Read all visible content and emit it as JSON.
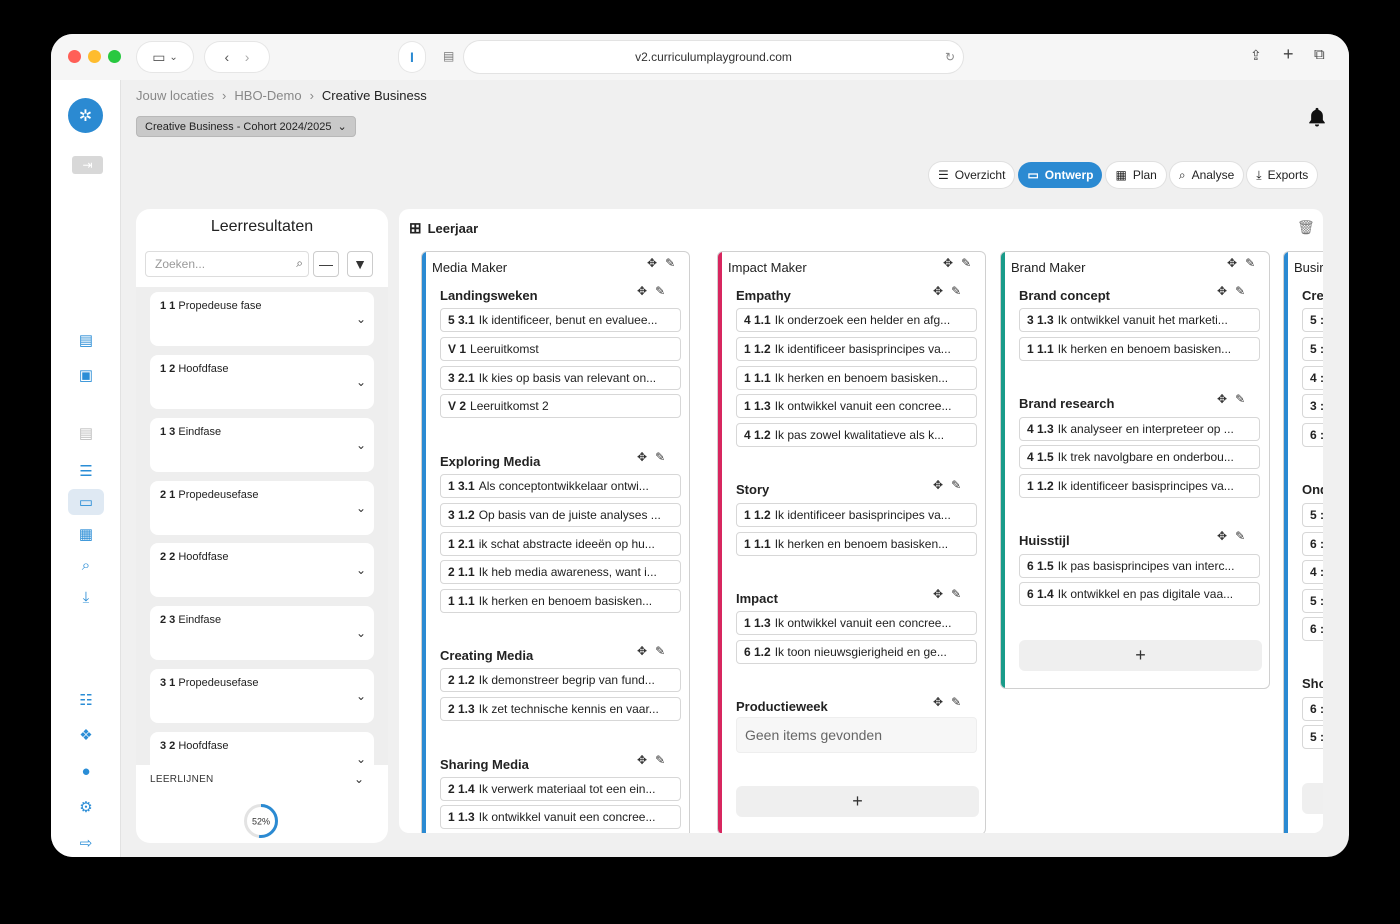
{
  "browser": {
    "url": "v2.curriculumplayground.com"
  },
  "breadcrumbs": [
    "Jouw locaties",
    "HBO-Demo",
    "Creative Business"
  ],
  "cohort": "Creative Business - Cohort 2024/2025",
  "tabs": [
    {
      "label": "Overzicht",
      "icon": "list-icon",
      "active": false
    },
    {
      "label": "Ontwerp",
      "icon": "layout-icon",
      "active": true
    },
    {
      "label": "Plan",
      "icon": "calendar-icon",
      "active": false
    },
    {
      "label": "Analyse",
      "icon": "search-icon",
      "active": false
    },
    {
      "label": "Exports",
      "icon": "download-icon",
      "active": false
    }
  ],
  "leerresultaten": {
    "title": "Leerresultaten",
    "search_placeholder": "Zoeken...",
    "phases": [
      {
        "num": "1 1",
        "label": "Propedeuse fase"
      },
      {
        "num": "1 2",
        "label": "Hoofdfase"
      },
      {
        "num": "1 3",
        "label": "Eindfase"
      },
      {
        "num": "2 1",
        "label": "Propedeusefase"
      },
      {
        "num": "2 2",
        "label": "Hoofdfase"
      },
      {
        "num": "2 3",
        "label": "Eindfase"
      },
      {
        "num": "3 1",
        "label": "Propedeusefase"
      },
      {
        "num": "3 2",
        "label": "Hoofdfase"
      }
    ],
    "leerlijnen": "LEERLIJNEN",
    "progress": "52%"
  },
  "board": {
    "title": "Leerjaar",
    "columns": [
      {
        "title": "Media Maker",
        "color": "#2b8ad2",
        "groups": [
          {
            "title": "Landingsweken",
            "items": [
              {
                "code": "5 3.1",
                "text": "Ik identificeer, benut en evaluee..."
              },
              {
                "code": "V 1",
                "text": "Leeruitkomst"
              },
              {
                "code": "3 2.1",
                "text": "Ik kies op basis van relevant on..."
              },
              {
                "code": "V 2",
                "text": "Leeruitkomst 2"
              }
            ]
          },
          {
            "title": "Exploring Media",
            "items": [
              {
                "code": "1 3.1",
                "text": "Als conceptontwikkelaar ontwi..."
              },
              {
                "code": "3 1.2",
                "text": "Op basis van de juiste analyses ..."
              },
              {
                "code": "1 2.1",
                "text": "ik schat abstracte ideeën op hu..."
              },
              {
                "code": "2 1.1",
                "text": "Ik heb media awareness, want i..."
              },
              {
                "code": "1 1.1",
                "text": "Ik herken en benoem basisken..."
              }
            ]
          },
          {
            "title": "Creating Media",
            "items": [
              {
                "code": "2 1.2",
                "text": "Ik demonstreer begrip van fund..."
              },
              {
                "code": "2 1.3",
                "text": "Ik zet technische kennis en vaar..."
              }
            ]
          },
          {
            "title": "Sharing Media",
            "items": [
              {
                "code": "2 1.4",
                "text": "Ik verwerk materiaal tot een ein..."
              },
              {
                "code": "1 1.3",
                "text": "Ik ontwikkel vanuit een concree..."
              }
            ]
          }
        ]
      },
      {
        "title": "Impact Maker",
        "color": "#d8265f",
        "groups": [
          {
            "title": "Empathy",
            "items": [
              {
                "code": "4 1.1",
                "text": "Ik onderzoek een helder en afg..."
              },
              {
                "code": "1 1.2",
                "text": "Ik identificeer basisprincipes va..."
              },
              {
                "code": "1 1.1",
                "text": "Ik herken en benoem basisken..."
              },
              {
                "code": "1 1.3",
                "text": "Ik ontwikkel vanuit een concree..."
              },
              {
                "code": "4 1.2",
                "text": "Ik pas zowel kwalitatieve als k..."
              }
            ]
          },
          {
            "title": "Story",
            "items": [
              {
                "code": "1 1.2",
                "text": "Ik identificeer basisprincipes va..."
              },
              {
                "code": "1 1.1",
                "text": "Ik herken en benoem basisken..."
              }
            ]
          },
          {
            "title": "Impact",
            "items": [
              {
                "code": "1 1.3",
                "text": "Ik ontwikkel vanuit een concree..."
              },
              {
                "code": "6 1.2",
                "text": "Ik toon nieuwsgierigheid en ge..."
              }
            ]
          },
          {
            "title": "Productieweek",
            "items": [],
            "empty": "Geen items gevonden"
          }
        ],
        "add": "+"
      },
      {
        "title": "Brand Maker",
        "color": "#1a9b8a",
        "groups": [
          {
            "title": "Brand concept",
            "items": [
              {
                "code": "3 1.3",
                "text": "Ik ontwikkel vanuit het marketi..."
              },
              {
                "code": "1 1.1",
                "text": "Ik herken en benoem basisken..."
              }
            ]
          },
          {
            "title": "Brand research",
            "items": [
              {
                "code": "4 1.3",
                "text": "Ik analyseer en interpreteer op ..."
              },
              {
                "code": "4 1.5",
                "text": "Ik trek navolgbare en onderbou..."
              },
              {
                "code": "1 1.2",
                "text": "Ik identificeer basisprincipes va..."
              }
            ]
          },
          {
            "title": "Huisstijl",
            "items": [
              {
                "code": "6 1.5",
                "text": "Ik pas basisprincipes van interc..."
              },
              {
                "code": "6 1.4",
                "text": "Ik ontwikkel en pas digitale vaa..."
              }
            ]
          }
        ],
        "add": "+"
      },
      {
        "title": "Busir",
        "color": "#2b8ad2",
        "groups": [
          {
            "title": "Cre",
            "codes": [
              "5 :",
              "5 :",
              "4 :",
              "3 :",
              "6 :"
            ]
          },
          {
            "title": "Ond",
            "codes": [
              "5 :",
              "6 :",
              "4 :",
              "5 :",
              "6 :"
            ]
          },
          {
            "title": "Sho",
            "codes": [
              "6 :",
              "5 :"
            ]
          }
        ]
      }
    ]
  }
}
